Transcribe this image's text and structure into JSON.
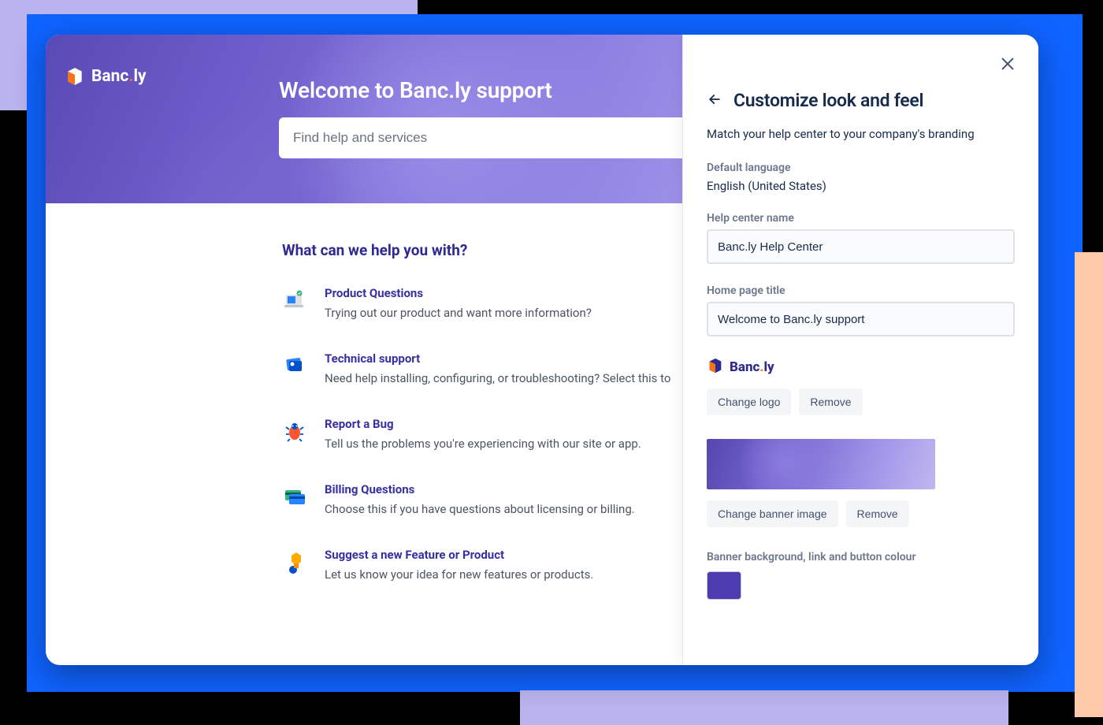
{
  "brand": {
    "name_pre": "Banc",
    "name_dot": ".",
    "name_post": "ly"
  },
  "hero": {
    "title": "Welcome to Banc.ly support",
    "search_placeholder": "Find help and services"
  },
  "categories": {
    "heading": "What can we help you with?",
    "items": [
      {
        "icon": "laptop-icon",
        "title": "Product Questions",
        "desc": "Trying out our product and want more information?"
      },
      {
        "icon": "support-icon",
        "title": "Technical support",
        "desc": "Need help installing, configuring, or troubleshooting? Select this to"
      },
      {
        "icon": "bug-icon",
        "title": "Report a Bug",
        "desc": "Tell us the problems you're experiencing with our site or app."
      },
      {
        "icon": "billing-icon",
        "title": "Billing Questions",
        "desc": "Choose this if you have questions about licensing or billing."
      },
      {
        "icon": "idea-icon",
        "title": "Suggest a new Feature or Product",
        "desc": "Let us know your idea for new features or products."
      }
    ]
  },
  "panel": {
    "title": "Customize look and feel",
    "subtitle": "Match your help center to your company's branding",
    "default_language_label": "Default language",
    "default_language_value": "English (United States)",
    "help_center_name_label": "Help center name",
    "help_center_name_value": "Banc.ly Help Center",
    "home_page_title_label": "Home page title",
    "home_page_title_value": "Welcome to Banc.ly support",
    "change_logo": "Change logo",
    "remove_logo": "Remove",
    "change_banner": "Change banner image",
    "remove_banner": "Remove",
    "banner_color_label": "Banner background, link and button colour",
    "banner_color": "#4d3bb0"
  }
}
